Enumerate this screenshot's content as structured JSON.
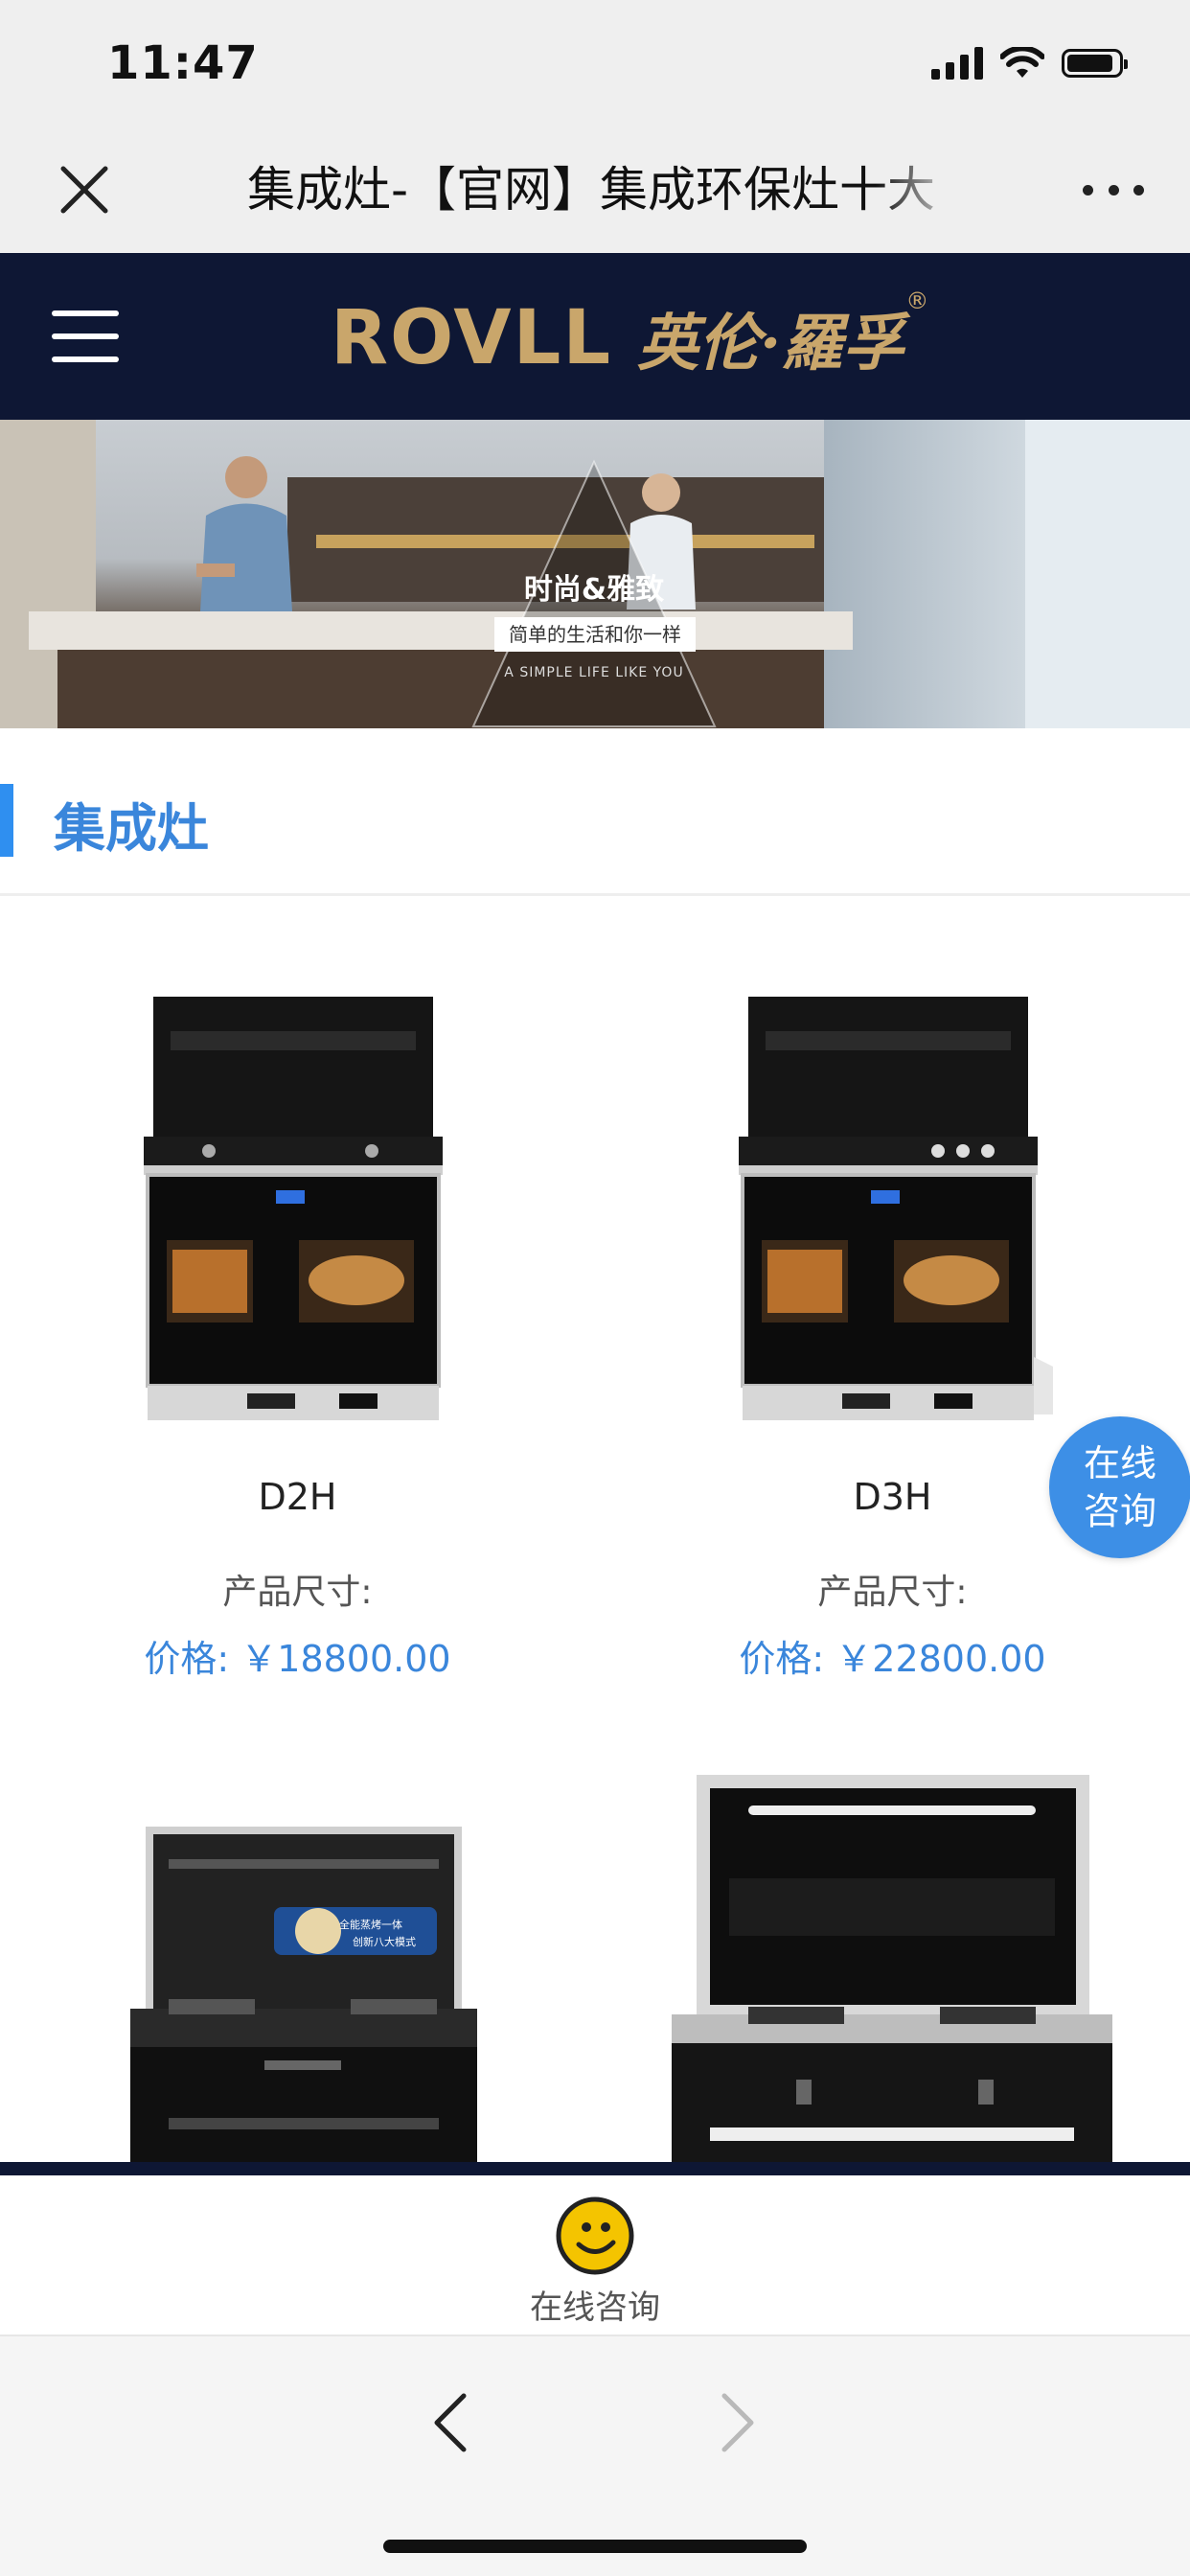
{
  "status_bar": {
    "time": "11:47"
  },
  "nav": {
    "title": "集成灶-【官网】集成环保灶十大"
  },
  "header": {
    "logo_en": "ROVLL",
    "logo_cn": "英伦·羅孚",
    "logo_reg": "®",
    "logo_color": "#c9a66b",
    "bg_color": "#0e1734"
  },
  "banner": {
    "heading": "时尚&雅致",
    "subheading": "简单的生活和你一样",
    "english": "A SIMPLE LIFE LIKE YOU"
  },
  "section": {
    "title": "集成灶",
    "accent": "#3a86db"
  },
  "products": [
    {
      "name": "D2H",
      "size_label": "产品尺寸:",
      "price_label": "价格:",
      "price": "￥18800.00"
    },
    {
      "name": "D3H",
      "size_label": "产品尺寸:",
      "price_label": "价格:",
      "price": "￥22800.00"
    },
    {
      "name": "",
      "size_label": "",
      "price_label": "",
      "price": "",
      "badge_line1": "全能蒸烤一体",
      "badge_line2": "创新八大模式"
    },
    {
      "name": "",
      "size_label": "",
      "price_label": "",
      "price": ""
    }
  ],
  "float_consult": {
    "line1": "在线",
    "line2": "咨询"
  },
  "consult_bar": {
    "label": "在线咨询"
  },
  "browser_nav": {
    "back_icon": "chevron-left-icon",
    "forward_icon": "chevron-right-icon"
  }
}
